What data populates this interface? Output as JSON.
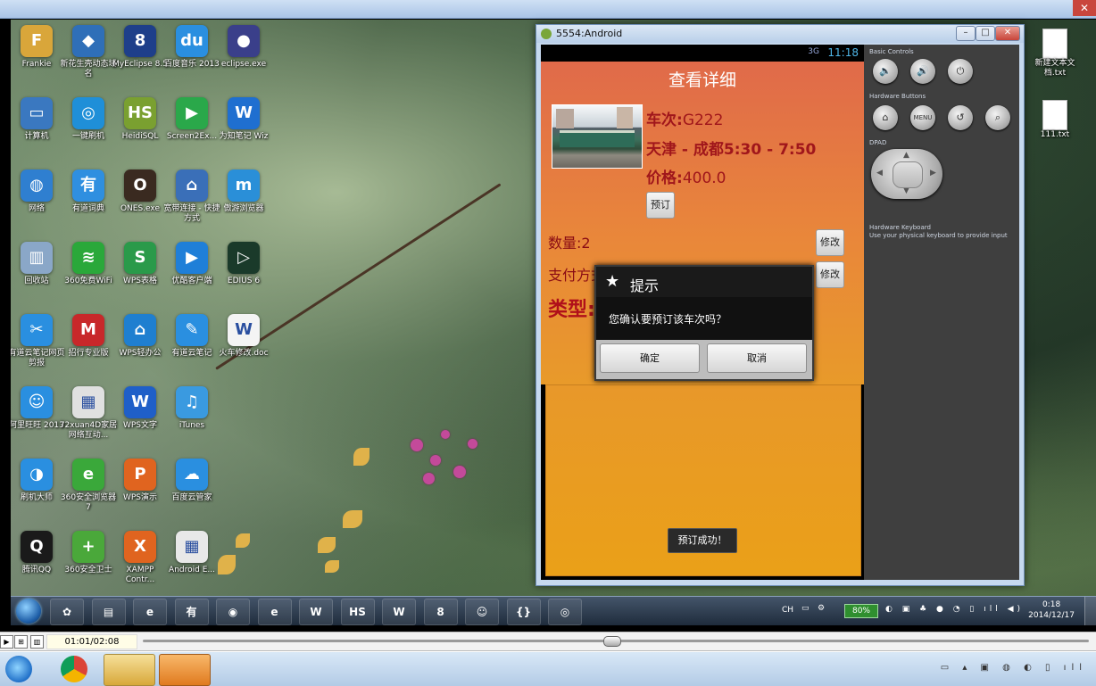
{
  "emulator": {
    "title": "5554:Android",
    "win_buttons": {
      "minimize": "–",
      "maximize": "□",
      "close": "✕"
    },
    "status_clock": "11:18",
    "status_signal": "3G",
    "app": {
      "title": "查看详细",
      "train_no_label": "车次:",
      "train_no": "G222",
      "route": "天津 - 成都5:30 - 7:50",
      "price_label": "价格:",
      "price": "400.0",
      "book_button": "预订",
      "quantity_label": "数量:2",
      "payment_label": "支付方式",
      "modify_button": "修改",
      "type_label": "类型:",
      "toast": "预订成功！"
    },
    "dialog": {
      "title": "提示",
      "message": "您确认要预订该车次吗？",
      "ok": "确定",
      "cancel": "取消"
    },
    "controls": {
      "basic": "Basic Controls",
      "hardware_buttons": "Hardware Buttons",
      "menu": "MENU",
      "dpad": "DPAD",
      "keyboard_title": "Hardware Keyboard",
      "keyboard_hint": "Use your physical keyboard to provide input"
    }
  },
  "desktop_icons": [
    {
      "label": "Frankie",
      "icon": "folder-icon",
      "color": "#d9a63a",
      "glyph": "F"
    },
    {
      "label": "新花生壳动态域名",
      "icon": "box-icon",
      "color": "#2f6fb8",
      "glyph": "◆"
    },
    {
      "label": "MyEclipse 8.5",
      "icon": "myeclipse-icon",
      "color": "#1e3f8a",
      "glyph": "8"
    },
    {
      "label": "百度音乐 2013",
      "icon": "baidu-music-icon",
      "color": "#2a8fe0",
      "glyph": "du"
    },
    {
      "label": "eclipse.exe",
      "icon": "eclipse-icon",
      "color": "#3a3f8a",
      "glyph": "●"
    },
    {
      "label": "计算机",
      "icon": "computer-icon",
      "color": "#3a78c0",
      "glyph": "▭"
    },
    {
      "label": "一键刷机",
      "icon": "flash-icon",
      "color": "#1f8fd8",
      "glyph": "◎"
    },
    {
      "label": "HeidiSQL",
      "icon": "heidisql-icon",
      "color": "#7aa030",
      "glyph": "HS"
    },
    {
      "label": "Screen2Ex...",
      "icon": "screen2exe-icon",
      "color": "#2aa84a",
      "glyph": "▶"
    },
    {
      "label": "为知笔记 Wiz",
      "icon": "wiz-icon",
      "color": "#1f6fd0",
      "glyph": "W"
    },
    {
      "label": "网络",
      "icon": "network-icon",
      "color": "#2f7fd0",
      "glyph": "◍"
    },
    {
      "label": "有道词典",
      "icon": "youdao-dict-icon",
      "color": "#2f8fe0",
      "glyph": "有"
    },
    {
      "label": "ONES.exe",
      "icon": "ones-icon",
      "color": "#3a2a20",
      "glyph": "O"
    },
    {
      "label": "宽带连接 - 快捷方式",
      "icon": "broadband-icon",
      "color": "#3a6fb8",
      "glyph": "⌂"
    },
    {
      "label": "傲游浏览器",
      "icon": "maxthon-icon",
      "color": "#2a8fd8",
      "glyph": "m"
    },
    {
      "label": "回收站",
      "icon": "recycle-bin-icon",
      "color": "#8aa7c8",
      "glyph": "▥"
    },
    {
      "label": "360免费WiFi",
      "icon": "wifi-icon",
      "color": "#2aa83a",
      "glyph": "≋"
    },
    {
      "label": "WPS表格",
      "icon": "wps-sheet-icon",
      "color": "#2a9a4a",
      "glyph": "S"
    },
    {
      "label": "优酷客户端",
      "icon": "youku-icon",
      "color": "#1f7fd8",
      "glyph": "▶"
    },
    {
      "label": "EDIUS 6",
      "icon": "edius-icon",
      "color": "#1a3a2a",
      "glyph": "▷"
    },
    {
      "label": "有道云笔记网页剪报",
      "icon": "clip-icon",
      "color": "#2a8fe0",
      "glyph": "✂"
    },
    {
      "label": "招行专业版",
      "icon": "cmb-icon",
      "color": "#c8282a",
      "glyph": "M"
    },
    {
      "label": "WPS轻办公",
      "icon": "wps-office-icon",
      "color": "#1f7fd0",
      "glyph": "⌂"
    },
    {
      "label": "有道云笔记",
      "icon": "youdao-note-icon",
      "color": "#2a8fe0",
      "glyph": "✎"
    },
    {
      "label": "火车修改.doc",
      "icon": "doc-icon",
      "color": "#f4f4f4",
      "glyph": "W"
    },
    {
      "label": "阿里旺旺 2013",
      "icon": "wangwang-icon",
      "color": "#2a8fe0",
      "glyph": "☺"
    },
    {
      "label": "72xuan4D家居网络互动...",
      "icon": "cube-icon",
      "color": "#e0e0e0",
      "glyph": "▦"
    },
    {
      "label": "WPS文字",
      "icon": "wps-writer-icon",
      "color": "#1f5fc8",
      "glyph": "W"
    },
    {
      "label": "iTunes",
      "icon": "itunes-icon",
      "color": "#3a9ae0",
      "glyph": "♫"
    },
    {
      "label": "",
      "icon": "spacer",
      "color": "",
      "glyph": ""
    },
    {
      "label": "刷机大师",
      "icon": "shuaji-icon",
      "color": "#2a8fe0",
      "glyph": "◑"
    },
    {
      "label": "360安全浏览器7",
      "icon": "360-browser-icon",
      "color": "#3aa83a",
      "glyph": "e"
    },
    {
      "label": "WPS演示",
      "icon": "wps-present-icon",
      "color": "#e0641f",
      "glyph": "P"
    },
    {
      "label": "百度云管家",
      "icon": "baidu-cloud-icon",
      "color": "#2a8fe0",
      "glyph": "☁"
    },
    {
      "label": "",
      "icon": "spacer",
      "color": "",
      "glyph": ""
    },
    {
      "label": "腾讯QQ",
      "icon": "qq-icon",
      "color": "#1a1a1a",
      "glyph": "Q"
    },
    {
      "label": "360安全卫士",
      "icon": "360-guard-icon",
      "color": "#4aa83a",
      "glyph": "+"
    },
    {
      "label": "XAMPP Contr...",
      "icon": "xampp-icon",
      "color": "#e0641f",
      "glyph": "X"
    },
    {
      "label": "Android E...",
      "icon": "android-emulator-icon",
      "color": "#e8e8e8",
      "glyph": "▦"
    }
  ],
  "right_icons": [
    {
      "label": "新建文本文档.txt"
    },
    {
      "label": "111.txt"
    }
  ],
  "taskbar": {
    "apps": [
      "windows-logo-icon",
      "explorer-icon",
      "ie-icon",
      "youdao-icon",
      "chrome-icon",
      "360-icon",
      "wps-icon",
      "heidisql-icon",
      "wps-writer-icon",
      "myeclipse-icon",
      "wangwang-icon",
      "android-icon",
      "emulator-icon"
    ],
    "app_glyphs": [
      "✿",
      "▤",
      "e",
      "有",
      "◉",
      "e",
      "W",
      "HS",
      "W",
      "8",
      "☺",
      "{}",
      "◎"
    ],
    "lang": "CH",
    "battery": "80%",
    "time": "0:18",
    "date": "2014/12/17"
  },
  "player": {
    "time": "01:01/02:08"
  },
  "outer_taskbar": {
    "apps": [
      "ie-icon",
      "chrome-icon",
      "explorer-icon",
      "recorder-icon"
    ]
  },
  "colors": {
    "app_orange": "#e9873a",
    "title_red": "#a0161b",
    "clock_blue": "#4fb6e8"
  }
}
